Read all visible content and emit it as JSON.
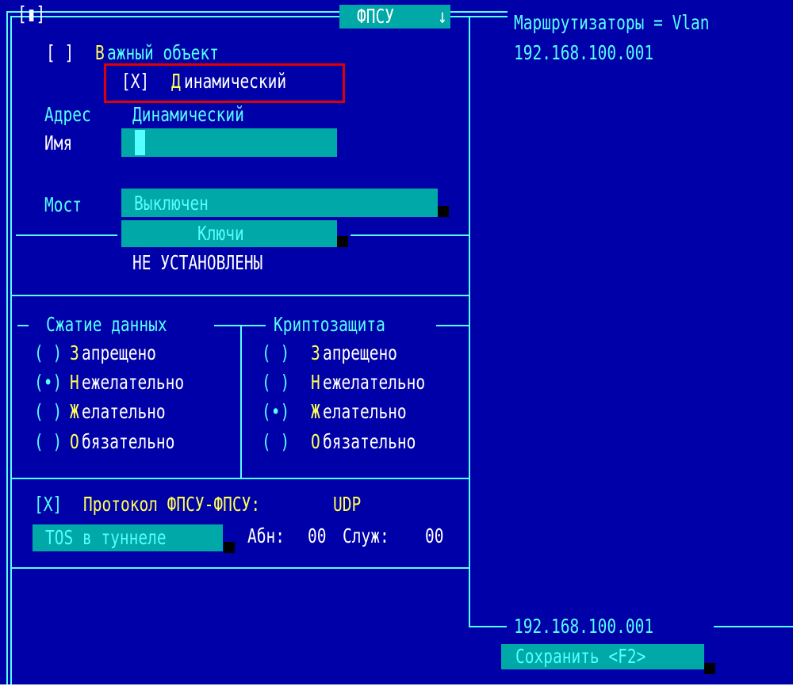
{
  "window": {
    "close_box": "[▮]",
    "tab_title": "ФПСУ",
    "tab_arrow": "↓",
    "right_title": "Маршрутизаторы = Vlan"
  },
  "routers": {
    "top_item": "192.168.100.001",
    "bottom_item": "192.168.100.001",
    "save_button": "Сохранить <F2>"
  },
  "object": {
    "important_checkbox": "[ ]",
    "important_hot": "В",
    "important_rest": "ажный объект",
    "dynamic_checkbox": "[X]",
    "dynamic_hot": "Д",
    "dynamic_rest": "инамический",
    "address_label": "Адрес",
    "address_value": "Динамический",
    "name_label": "Имя",
    "name_value": "",
    "bridge_label": "Мост",
    "bridge_value": "Выключен",
    "keys_button": "Ключи",
    "keys_status": "НЕ УСТАНОВЛЕНЫ"
  },
  "compression": {
    "title": "Сжатие данных",
    "options": [
      {
        "mark": "( )",
        "hot": "З",
        "rest": "апрещено"
      },
      {
        "mark": "(•)",
        "hot": "Н",
        "rest": "ежелательно"
      },
      {
        "mark": "( )",
        "hot": "Ж",
        "rest": "елательно"
      },
      {
        "mark": "( )",
        "hot": "О",
        "rest": "бязательно"
      }
    ]
  },
  "crypto": {
    "title": "Криптозащита",
    "options": [
      {
        "mark": "( )",
        "hot": "З",
        "rest": "апрещено"
      },
      {
        "mark": "( )",
        "hot": "Н",
        "rest": "ежелательно"
      },
      {
        "mark": "(•)",
        "hot": "Ж",
        "rest": "елательно"
      },
      {
        "mark": "( )",
        "hot": "О",
        "rest": "бязательно"
      }
    ]
  },
  "protocol": {
    "checkbox": "[X]",
    "label": "Протокол ФПСУ-ФПСУ:",
    "value": "UDP",
    "tos_button": "TOS в туннеле",
    "abn_label": "Абн:",
    "abn_value": "00",
    "serv_label": "Служ:",
    "serv_value": "00"
  }
}
